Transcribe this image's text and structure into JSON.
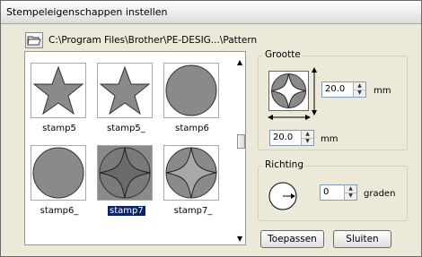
{
  "window": {
    "title": "Stempeleigenschappen instellen"
  },
  "path": {
    "text": "C:\\Program Files\\Brother\\PE-DESIG...\\Pattern"
  },
  "stamps": [
    {
      "label": "stamp5",
      "shape": "star",
      "selected": false
    },
    {
      "label": "stamp5_",
      "shape": "star",
      "selected": false
    },
    {
      "label": "stamp6",
      "shape": "circle",
      "selected": false
    },
    {
      "label": "stamp6_",
      "shape": "circle",
      "selected": false
    },
    {
      "label": "stamp7",
      "shape": "astroid",
      "selected": true
    },
    {
      "label": "stamp7_",
      "shape": "astroid",
      "selected": false
    }
  ],
  "size_group": {
    "label": "Grootte",
    "height_value": "20.0",
    "width_value": "20.0",
    "unit_height": "mm",
    "unit_width": "mm"
  },
  "direction_group": {
    "label": "Richting",
    "value": "0",
    "unit": "graden"
  },
  "buttons": {
    "apply": "Toepassen",
    "close": "Sluiten"
  },
  "colors": {
    "shape_fill": "#8a8a8a",
    "selected_bg": "#0a246a"
  }
}
